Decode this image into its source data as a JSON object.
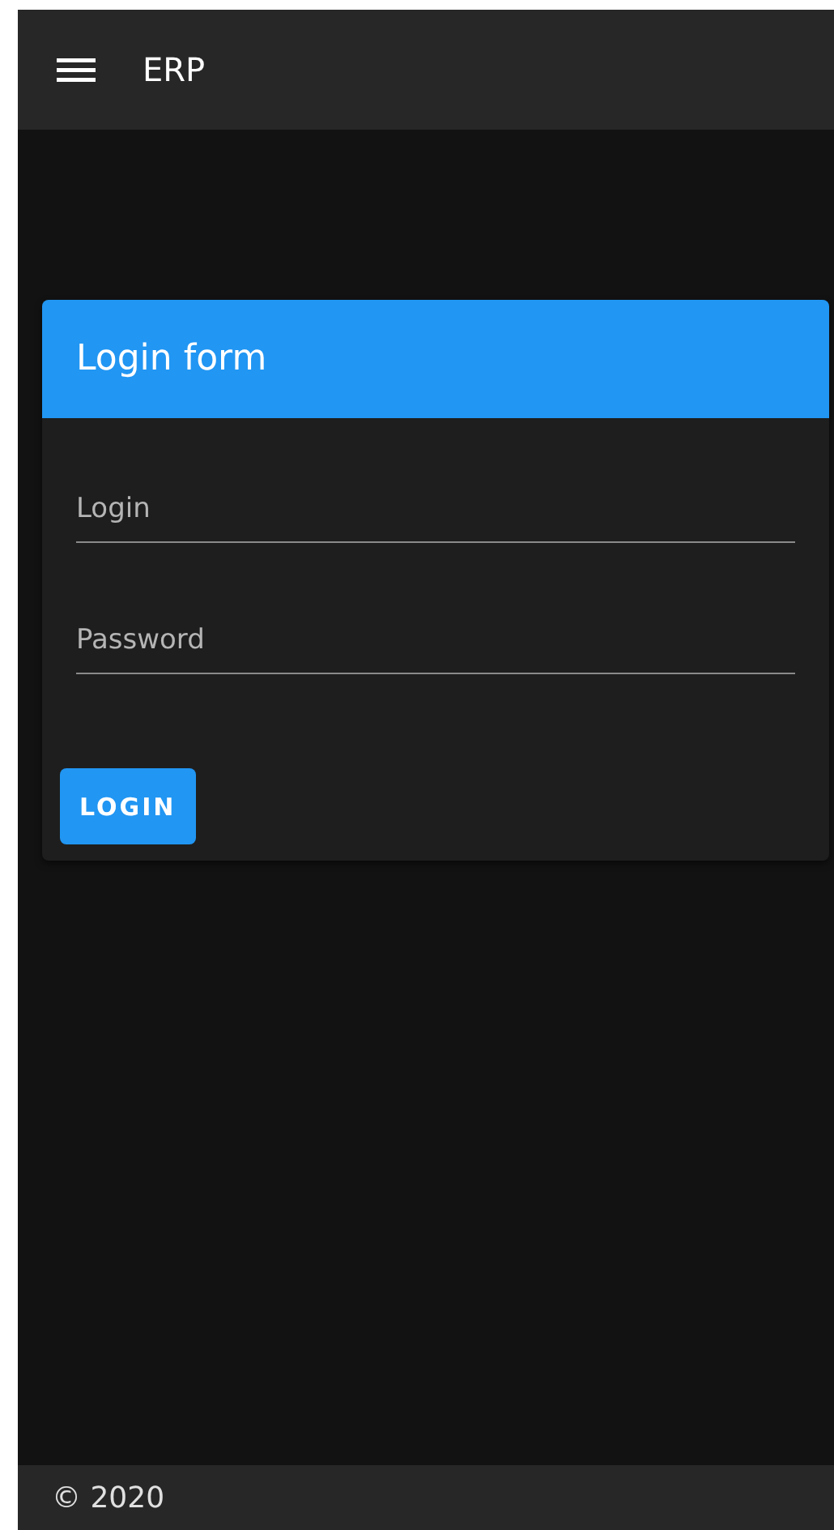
{
  "app_bar": {
    "title": "ERP"
  },
  "login_form": {
    "title": "Login form",
    "fields": [
      {
        "placeholder": "Login"
      },
      {
        "placeholder": "Password"
      }
    ],
    "button": "LOGIN"
  },
  "footer": {
    "text": "© 2020"
  }
}
